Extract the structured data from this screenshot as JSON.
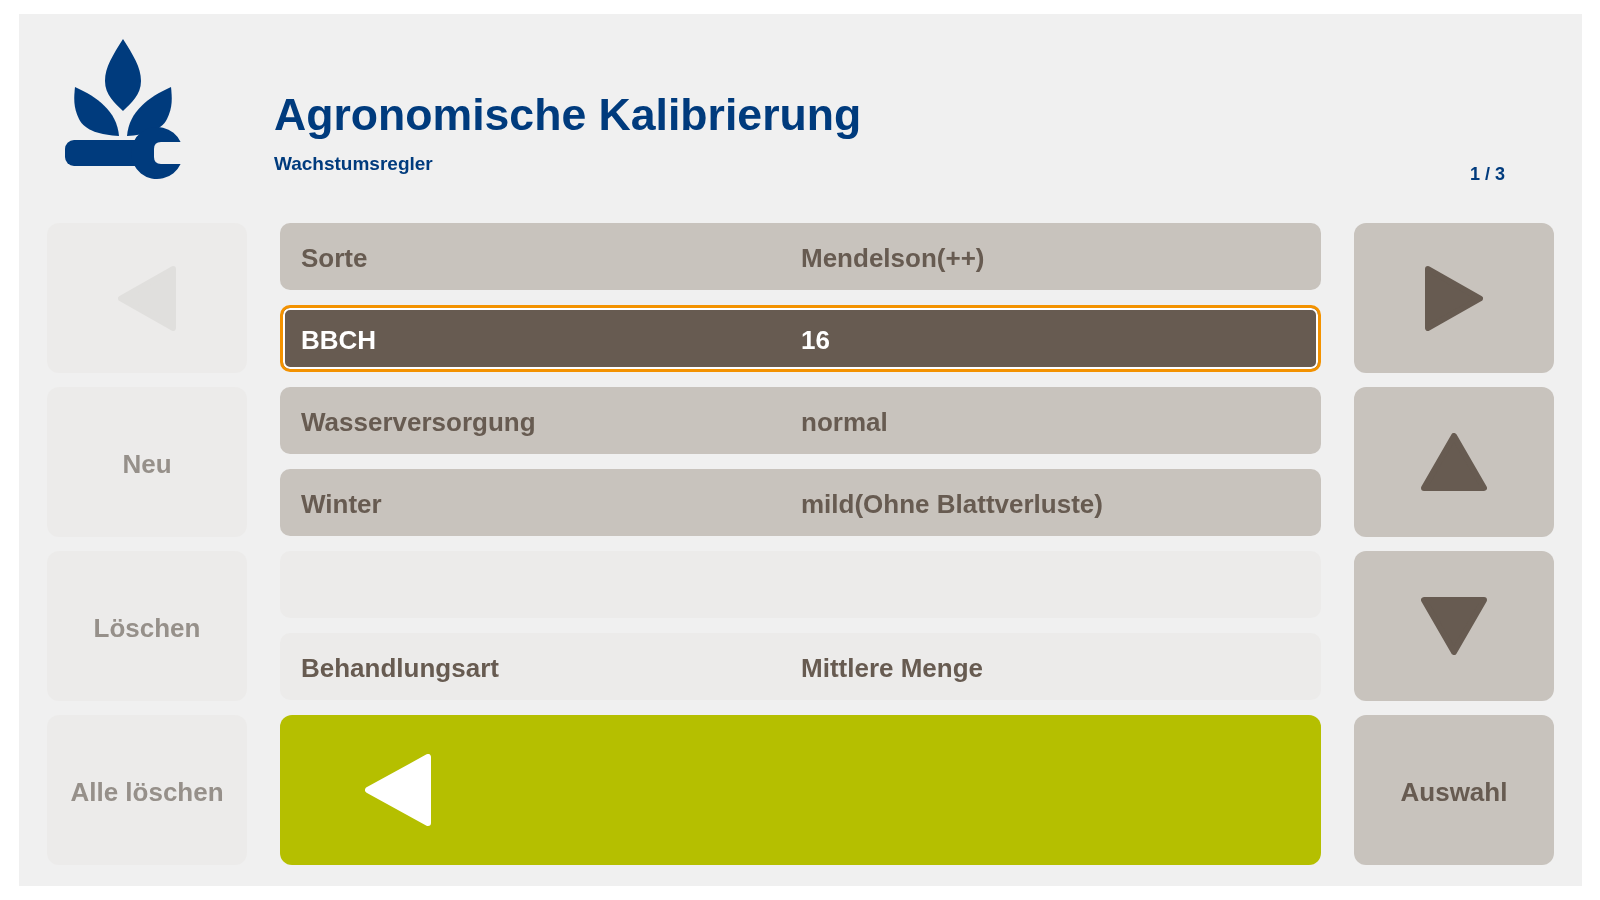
{
  "header": {
    "title": "Agronomische Kalibrierung",
    "subtitle": "Wachstumsregler",
    "page_indicator": "1 / 3"
  },
  "left_buttons": [
    {
      "kind": "previous",
      "disabled": true
    },
    {
      "kind": "text",
      "label": "Neu",
      "disabled": true
    },
    {
      "kind": "text",
      "label": "Löschen",
      "disabled": true
    },
    {
      "kind": "text",
      "label": "Alle löschen",
      "disabled": true
    }
  ],
  "rows": [
    {
      "kind": "field",
      "label": "Sorte",
      "value": "Mendelson(++)",
      "selected": false,
      "disabled": false
    },
    {
      "kind": "field",
      "label": "BBCH",
      "value": "16",
      "selected": true,
      "disabled": false
    },
    {
      "kind": "field",
      "label": "Wasserversorgung",
      "value": "normal",
      "selected": false,
      "disabled": false
    },
    {
      "kind": "field",
      "label": "Winter",
      "value": "mild(Ohne Blattverluste)",
      "selected": false,
      "disabled": false
    },
    {
      "kind": "empty",
      "selected": false,
      "disabled": true
    },
    {
      "kind": "field",
      "label": "Behandlungsart",
      "value": "Mittlere Menge",
      "selected": false,
      "disabled": true
    }
  ],
  "right_buttons": [
    {
      "kind": "next",
      "disabled": false
    },
    {
      "kind": "up",
      "disabled": false
    },
    {
      "kind": "down",
      "disabled": false
    },
    {
      "kind": "text",
      "label": "Auswahl",
      "disabled": false
    }
  ]
}
